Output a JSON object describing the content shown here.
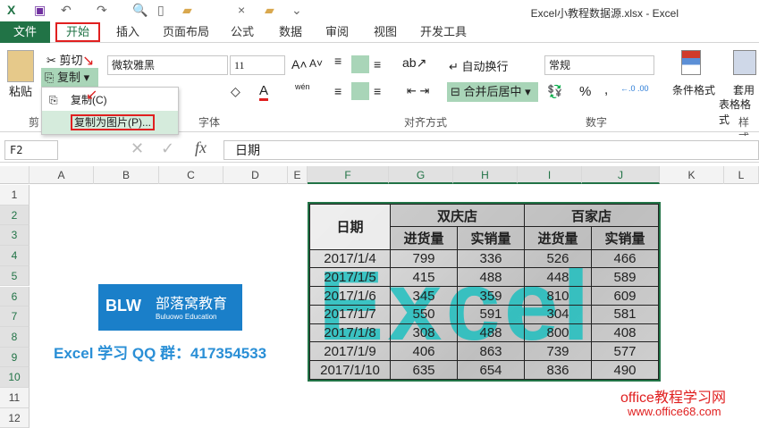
{
  "window": {
    "title": "Excel小教程数据源.xlsx - Excel"
  },
  "tabs": [
    "文件",
    "开始",
    "插入",
    "页面布局",
    "公式",
    "数据",
    "审阅",
    "视图",
    "开发工具"
  ],
  "ribbon": {
    "paste": "粘贴",
    "cut": "剪切",
    "copy": "复制",
    "font_name": "微软雅黑",
    "font_size": "11",
    "wrap": "自动换行",
    "merge": "合并后居中",
    "number_format": "常规",
    "cond_format": "条件格式",
    "table_format_1": "套用",
    "table_format_2": "表格格式",
    "groups": {
      "clipboard": "剪",
      "font": "字体",
      "align": "对齐方式",
      "number": "数字",
      "styles": "样式"
    },
    "percent": "%",
    "comma": ",",
    "phonetic": "wén"
  },
  "copy_menu": {
    "items": [
      "复制(C)",
      "复制为图片(P)..."
    ]
  },
  "formula_bar": {
    "name_box": "F2",
    "value": "日期",
    "fx": "fx"
  },
  "columns": [
    "A",
    "B",
    "C",
    "D",
    "E",
    "F",
    "G",
    "H",
    "I",
    "J",
    "K",
    "L"
  ],
  "rows": [
    "1",
    "2",
    "3",
    "4",
    "5",
    "6",
    "7",
    "8",
    "9",
    "10",
    "11",
    "12"
  ],
  "picture_table": {
    "header": {
      "date": "日期",
      "store1": "双庆店",
      "store2": "百家店",
      "in": "进货量",
      "sold": "实销量"
    },
    "rows": [
      [
        "2017/1/4",
        "799",
        "336",
        "526",
        "466"
      ],
      [
        "2017/1/5",
        "415",
        "488",
        "448",
        "589"
      ],
      [
        "2017/1/6",
        "345",
        "359",
        "810",
        "609"
      ],
      [
        "2017/1/7",
        "550",
        "591",
        "304",
        "581"
      ],
      [
        "2017/1/8",
        "308",
        "488",
        "800",
        "408"
      ],
      [
        "2017/1/9",
        "406",
        "863",
        "739",
        "577"
      ],
      [
        "2017/1/10",
        "635",
        "654",
        "836",
        "490"
      ]
    ],
    "watermark": "Excel"
  },
  "logo": {
    "text": "部落窝教育",
    "sub": "Buluowo Education",
    "mark": "BLW"
  },
  "qq_text": "Excel 学习 QQ 群：417354533",
  "site_watermark": {
    "name": "office教程学习网",
    "url": "www.office68.com"
  }
}
